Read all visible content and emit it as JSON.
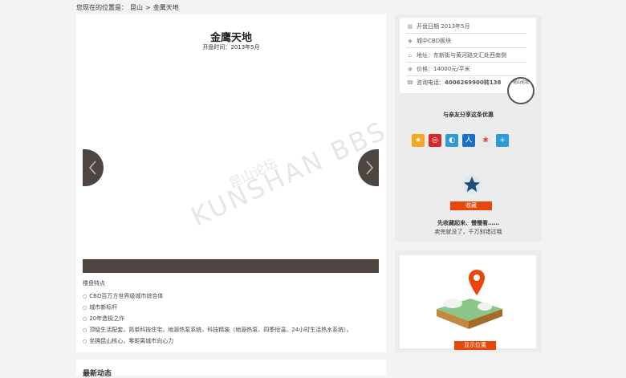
{
  "breadcrumb": {
    "prefix": "您现在的位置是：",
    "city": "昆山",
    "separator": ">",
    "current": "金鹰天地"
  },
  "project": {
    "title": "金鹰天地",
    "open_date": "开盘时间：2013年5月"
  },
  "watermark": {
    "text": "KUNSHAN BBS",
    "cn": "昆山论坛"
  },
  "features": {
    "heading": "楼盘特点",
    "items": [
      "CBD百万方世界级城市综合体",
      "城市新标杆",
      "20年造极之作",
      "顶级生活配套，简单科技住宅，地源热泵系统，科技精装（地源热泵、四季恒温、24小时生活热水系统）。",
      "坐拥昆山核心，零距离城市向心力"
    ]
  },
  "news": {
    "title": "最新动态"
  },
  "info": {
    "open_date": "开盘日期 2013年5月",
    "district": "城中CBD板块",
    "address": "地址：东新街与黄河路交汇处西南侧",
    "price": "价格：14000元/平米",
    "phone_label": "咨询电话：",
    "phone": "4006269900转138",
    "stamp": "昆山论坛"
  },
  "share": {
    "title": "与亲友分享这条优惠",
    "icons": [
      "qzone-icon",
      "weibo-icon",
      "tencent-weibo-icon",
      "renren-icon",
      "kaixin-icon",
      "more-share-icon"
    ],
    "colors": [
      "#f5a623",
      "#d6282b",
      "#2f9ad6",
      "#1a6fc4",
      "#d6282b",
      "#2f9ad6"
    ]
  },
  "favorite": {
    "button": "收藏",
    "line1": "先收藏起来、慢慢看……",
    "line2": "卖完就没了，千万别错过哦"
  },
  "map": {
    "button": "显示位置"
  },
  "accent": "#e8470c"
}
